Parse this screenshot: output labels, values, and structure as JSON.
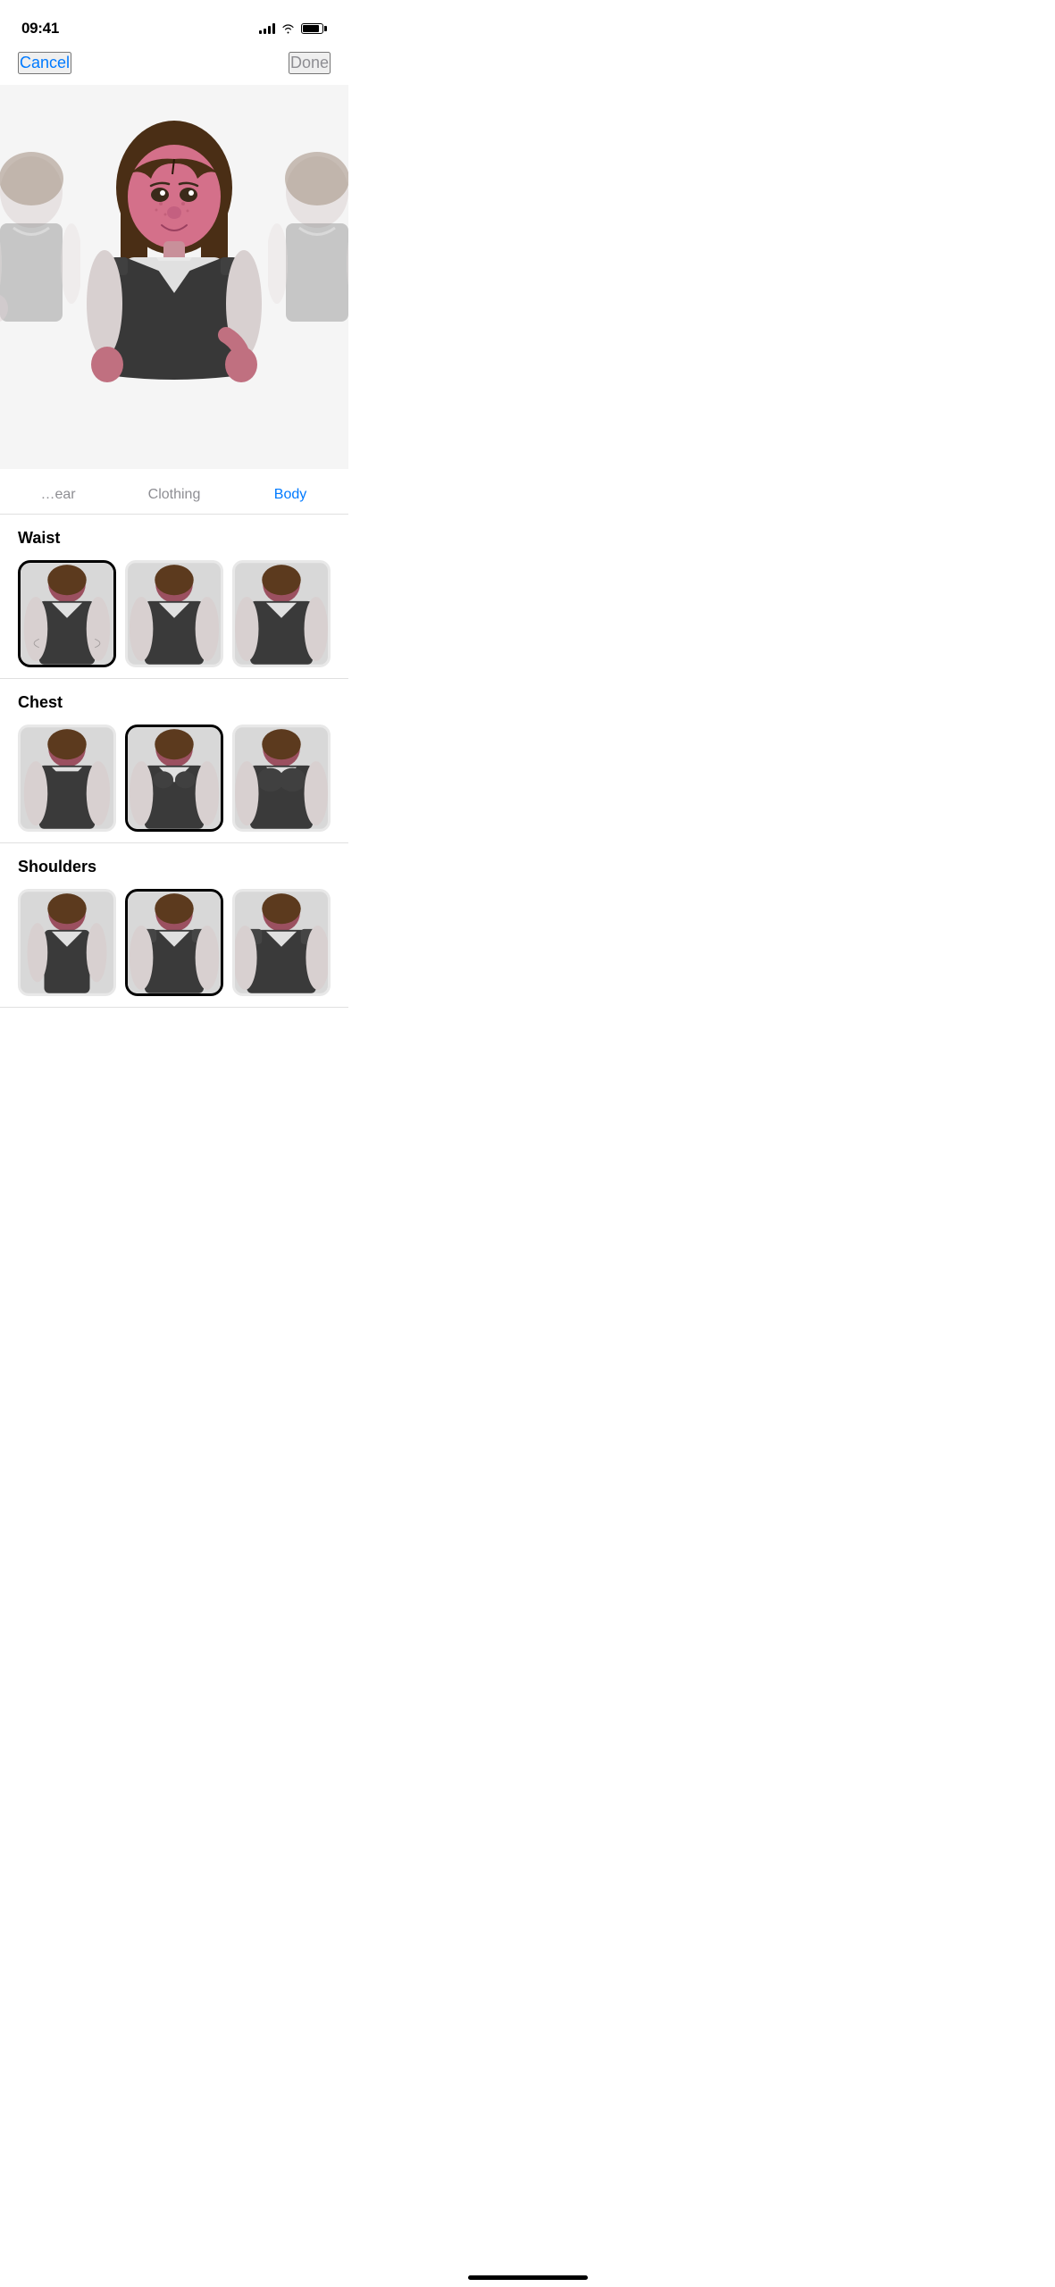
{
  "statusBar": {
    "time": "09:41",
    "signalBars": [
      4,
      6,
      8,
      10,
      12
    ],
    "battery": 85
  },
  "navigation": {
    "cancelLabel": "Cancel",
    "doneLabel": "Done"
  },
  "tabs": [
    {
      "id": "headwear",
      "label": "…ear",
      "active": false
    },
    {
      "id": "clothing",
      "label": "Clothing",
      "active": false
    },
    {
      "id": "body",
      "label": "Body",
      "active": true
    }
  ],
  "sections": [
    {
      "id": "waist",
      "title": "Waist",
      "options": [
        {
          "id": "waist-1",
          "selected": true
        },
        {
          "id": "waist-2",
          "selected": false
        },
        {
          "id": "waist-3",
          "selected": false
        }
      ]
    },
    {
      "id": "chest",
      "title": "Chest",
      "options": [
        {
          "id": "chest-1",
          "selected": false
        },
        {
          "id": "chest-2",
          "selected": true
        },
        {
          "id": "chest-3",
          "selected": false
        }
      ]
    },
    {
      "id": "shoulders",
      "title": "Shoulders",
      "options": [
        {
          "id": "shoulders-1",
          "selected": false
        },
        {
          "id": "shoulders-2",
          "selected": true
        },
        {
          "id": "shoulders-3",
          "selected": false
        }
      ]
    }
  ],
  "colors": {
    "accent": "#007AFF",
    "text": "#000000",
    "muted": "#8E8E93",
    "separator": "#e0e0e0",
    "avatarSkin": "#E8A0B0",
    "avatarPink": "#C06080",
    "avatarHair": "#5C3A1E",
    "avatarVest": "#3A3A3A",
    "avatarShirt": "#E8E8E8"
  }
}
